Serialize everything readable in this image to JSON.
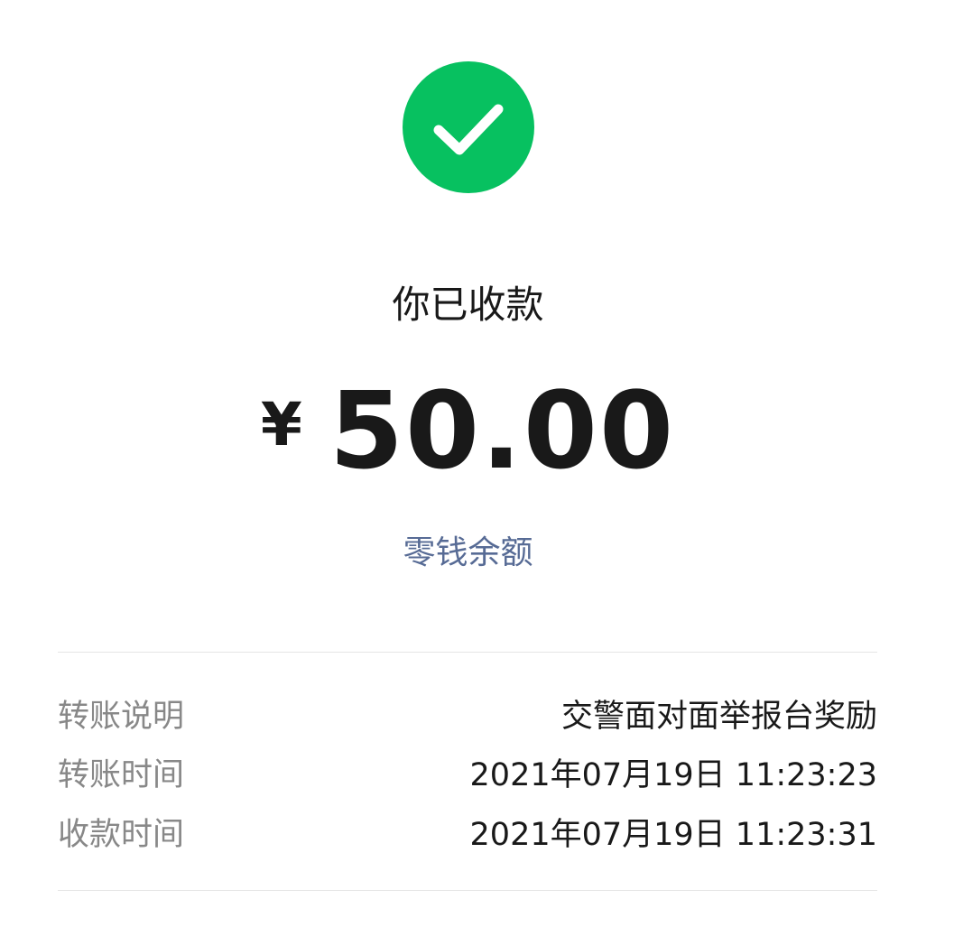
{
  "status": {
    "title": "你已收款",
    "icon": "checkmark-circle-icon",
    "icon_color": "#07C160"
  },
  "amount": {
    "currency": "¥",
    "value": "50.00"
  },
  "balance_link": {
    "label": "零钱余额",
    "color": "#576B95"
  },
  "details": [
    {
      "label": "转账说明",
      "value": "交警面对面举报台奖励"
    },
    {
      "label": "转账时间",
      "value": "2021年07月19日 11:23:23"
    },
    {
      "label": "收款时间",
      "value": "2021年07月19日 11:23:31"
    }
  ]
}
